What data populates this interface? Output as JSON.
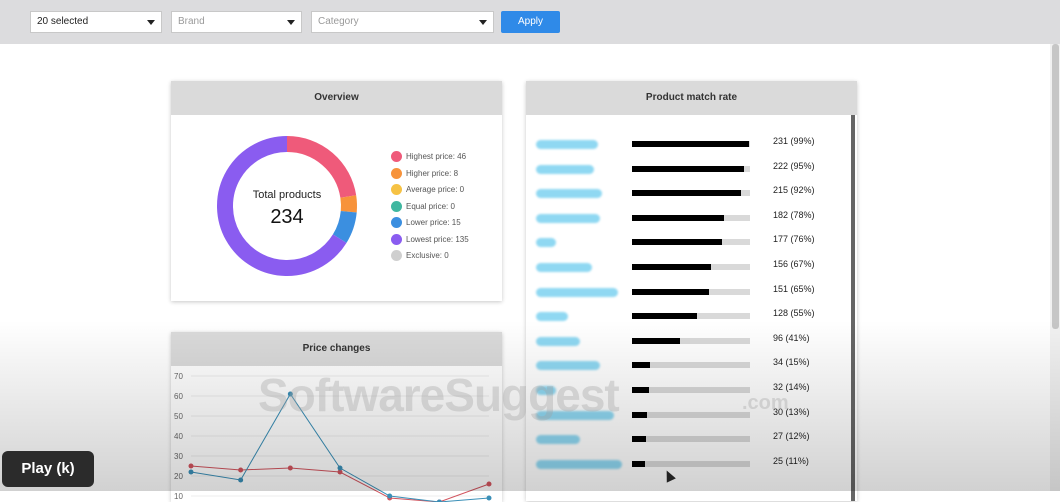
{
  "filters": {
    "selection": "20 selected",
    "brand_placeholder": "Brand",
    "category_placeholder": "Category",
    "apply_label": "Apply"
  },
  "overview": {
    "title": "Overview",
    "total_label": "Total products",
    "total_value": "234",
    "legend": [
      {
        "label": "Highest price: 46",
        "color": "#ef5a7a",
        "value": 46
      },
      {
        "label": "Higher price: 8",
        "color": "#f7933b",
        "value": 8
      },
      {
        "label": "Average price: 0",
        "color": "#f6c244",
        "value": 0
      },
      {
        "label": "Equal price: 0",
        "color": "#3fb7a0",
        "value": 0
      },
      {
        "label": "Lower price: 15",
        "color": "#3b8fe0",
        "value": 15
      },
      {
        "label": "Lowest price: 135",
        "color": "#8a5cf0",
        "value": 135
      },
      {
        "label": "Exclusive: 0",
        "color": "#cfcfcf",
        "value": 0
      }
    ]
  },
  "product_match": {
    "title": "Product match rate",
    "rows": [
      {
        "value": "231 (99%)",
        "pct": 99
      },
      {
        "value": "222 (95%)",
        "pct": 95
      },
      {
        "value": "215 (92%)",
        "pct": 92
      },
      {
        "value": "182 (78%)",
        "pct": 78
      },
      {
        "value": "177 (76%)",
        "pct": 76
      },
      {
        "value": "156 (67%)",
        "pct": 67
      },
      {
        "value": "151 (65%)",
        "pct": 65
      },
      {
        "value": "128 (55%)",
        "pct": 55
      },
      {
        "value": "96 (41%)",
        "pct": 41
      },
      {
        "value": "34 (15%)",
        "pct": 15
      },
      {
        "value": "32 (14%)",
        "pct": 14
      },
      {
        "value": "30 (13%)",
        "pct": 13
      },
      {
        "value": "27 (12%)",
        "pct": 12
      },
      {
        "value": "25 (11%)",
        "pct": 11
      }
    ]
  },
  "price_changes": {
    "title": "Price changes"
  },
  "chart_data": {
    "type": "line",
    "title": "Price changes",
    "ylim": [
      0,
      70
    ],
    "yticks": [
      10,
      20,
      30,
      40,
      50,
      60,
      70
    ],
    "series": [
      {
        "color": "#d2545e",
        "values": [
          25,
          23,
          24,
          22,
          9,
          7,
          16
        ]
      },
      {
        "color": "#3a8fb7",
        "values": [
          22,
          18,
          61,
          24,
          10,
          7,
          9
        ]
      }
    ]
  },
  "overlay": {
    "watermark": "SoftwareSuggest",
    "watermark_suffix": ".com",
    "play_label": "Play (k)"
  }
}
